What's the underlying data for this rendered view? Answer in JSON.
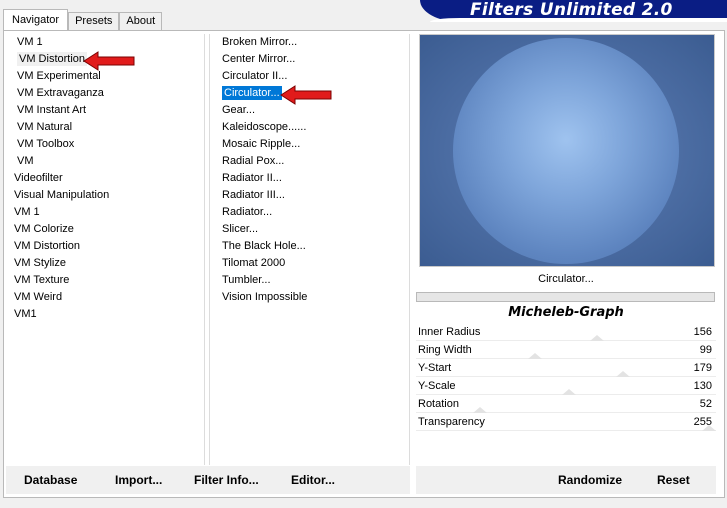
{
  "tabs": [
    {
      "label": "Navigator",
      "active": true
    },
    {
      "label": "Presets",
      "active": false
    },
    {
      "label": "About",
      "active": false
    }
  ],
  "title": "Filters Unlimited 2.0",
  "categories": [
    "VM 1",
    "VM Distortion",
    "VM Experimental",
    "VM Extravaganza",
    "VM Instant Art",
    "VM Natural",
    "VM Toolbox",
    "VM",
    "Videofilter",
    "Visual Manipulation",
    "VM 1",
    "VM Colorize",
    "VM Distortion",
    "VM Stylize",
    "VM Texture",
    "VM Weird",
    "VM1"
  ],
  "filters": [
    "Broken Mirror...",
    "Center Mirror...",
    "Circulator II...",
    "Circulator...",
    "Gear...",
    "Kaleidoscope......",
    "Mosaic Ripple...",
    "Radial Pox...",
    "Radiator II...",
    "Radiator III...",
    "Radiator...",
    "Slicer...",
    "The Black Hole...",
    "Tilomat 2000",
    "Tumbler...",
    "Vision Impossible"
  ],
  "preview": {
    "filter_name": "Circulator...",
    "author": "Micheleb-Graph"
  },
  "params": [
    {
      "name": "Inner Radius",
      "value": "156",
      "level": 0.61
    },
    {
      "name": "Ring Width",
      "value": "99",
      "level": 0.39
    },
    {
      "name": "Y-Start",
      "value": "179",
      "level": 0.7
    },
    {
      "name": "Y-Scale",
      "value": "130",
      "level": 0.51
    },
    {
      "name": "Rotation",
      "value": "52",
      "level": 0.2
    },
    {
      "name": "Transparency",
      "value": "255",
      "level": 1.0
    }
  ],
  "buttons": {
    "database": "Database",
    "import": "Import...",
    "filter_info": "Filter Info...",
    "editor": "Editor...",
    "randomize": "Randomize",
    "reset": "Reset"
  },
  "colors": {
    "banner": "#0a1d84",
    "selection": "#0078d7",
    "arrow": "#e11b1b"
  },
  "icons": [
    "red-arrow-icon"
  ]
}
